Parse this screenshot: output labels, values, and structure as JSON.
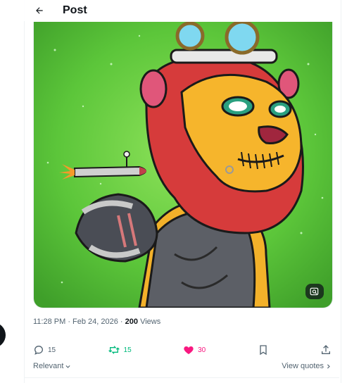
{
  "header": {
    "title": "Post"
  },
  "post": {
    "timestamp": "11:28 PM · Feb 24, 2026 · ",
    "views_count": "200",
    "views_label": " Views"
  },
  "actions": {
    "replies": "15",
    "reposts": "15",
    "likes": "30"
  },
  "sort": {
    "label": "Relevant"
  },
  "quotes": {
    "label": "View quotes"
  },
  "colors": {
    "accent_green": "#00ba7c",
    "like_pink": "#f91880",
    "text_secondary": "#536471"
  }
}
